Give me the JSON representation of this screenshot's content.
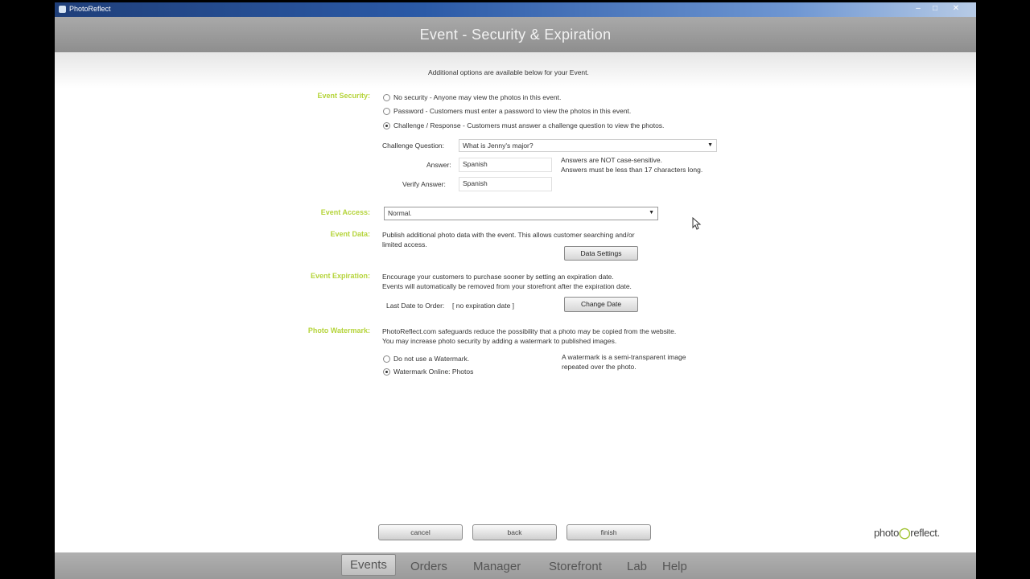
{
  "window": {
    "app_title": "PhotoReflect"
  },
  "header": {
    "title": "Event - Security & Expiration"
  },
  "intro": "Additional options are available below for your Event.",
  "security": {
    "label": "Event Security:",
    "options": [
      {
        "label": "No security - Anyone may view the photos in this event.",
        "checked": false
      },
      {
        "label": "Password - Customers must enter a password to view the photos in this event.",
        "checked": false
      },
      {
        "label": "Challenge / Response - Customers must answer a challenge question to view the photos.",
        "checked": true
      }
    ],
    "question_label": "Challenge Question:",
    "question_value": "What is Jenny's major?",
    "answer_label": "Answer:",
    "answer_value": "Spanish",
    "verify_label": "Verify Answer:",
    "verify_value": "Spanish",
    "hint_1": "Answers are NOT case-sensitive.",
    "hint_2": "Answers must be less than 17 characters long."
  },
  "access": {
    "label": "Event Access:",
    "value": "Normal."
  },
  "data": {
    "label": "Event Data:",
    "desc_1": "Publish additional photo data with the event. This allows customer searching and/or",
    "desc_2": "limited access.",
    "button": "Data Settings"
  },
  "expiration": {
    "label": "Event Expiration:",
    "desc_1": "Encourage your customers to purchase sooner by setting an expiration date.",
    "desc_2": "Events will automatically be removed from your storefront after the expiration date.",
    "last_date_label": "Last Date to Order:",
    "last_date_value": "[ no expiration date ]",
    "button": "Change Date"
  },
  "watermark": {
    "label": "Photo Watermark:",
    "desc_1": "PhotoReflect.com safeguards reduce the possibility that a photo may be copied from the website.",
    "desc_2": "You may increase photo security by adding a watermark to published images.",
    "options": [
      {
        "label": "Do not use a Watermark.",
        "checked": false
      },
      {
        "label": "Watermark Online: Photos",
        "checked": true
      }
    ],
    "note_1": "A watermark is a semi-transparent image",
    "note_2": "repeated over the photo."
  },
  "wizard": {
    "cancel": "cancel",
    "back": "back",
    "finish": "finish"
  },
  "logo": {
    "left": "photo",
    "right": "reflect."
  },
  "nav": {
    "items": [
      "Events",
      "Orders",
      "Manager",
      "Storefront",
      "Lab",
      "Help"
    ]
  }
}
